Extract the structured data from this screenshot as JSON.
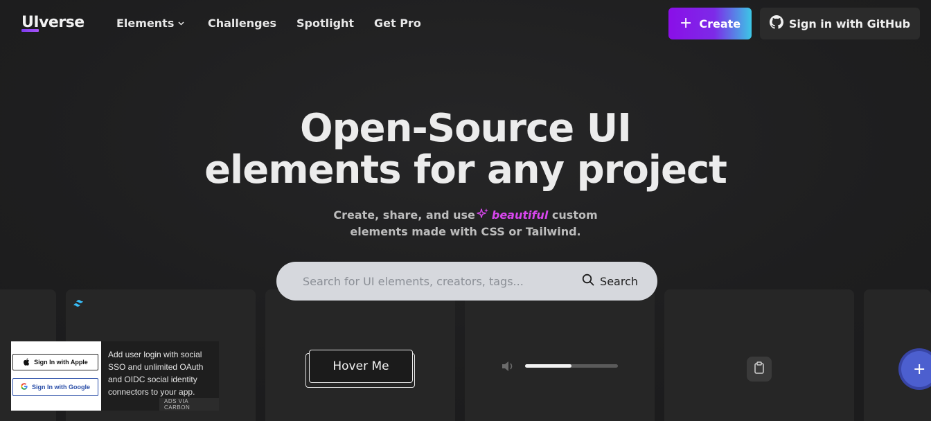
{
  "nav": {
    "logo_ui": "UI",
    "logo_rest": "verse",
    "links": [
      {
        "label": "Elements",
        "has_dropdown": true
      },
      {
        "label": "Challenges"
      },
      {
        "label": "Spotlight"
      },
      {
        "label": "Get Pro"
      }
    ],
    "create_label": "Create",
    "github_label": "Sign in with GitHub"
  },
  "hero": {
    "title_line1": "Open-Source UI",
    "title_line2": "elements for any project",
    "subtitle_pre": "Create, share, and use",
    "subtitle_highlight": "beautiful",
    "subtitle_post": "custom",
    "subtitle_line2": "elements made with CSS or Tailwind."
  },
  "search": {
    "placeholder": "Search for UI elements, creators, tags...",
    "button_label": "Search"
  },
  "cards": {
    "hover_button_label": "Hover Me",
    "volume_level": 0.5
  },
  "ad": {
    "apple_label": "Sign In with Apple",
    "google_label": "Sign In with Google",
    "text": "Add user login with social SSO and unlimited OAuth and OIDC social identity connectors to your app.",
    "via_label": "ADS VIA CARBON"
  },
  "colors": {
    "background": "#212121",
    "accent_purple": "#8a0fe8",
    "accent_cyan": "#3cc7e6",
    "highlight_pink": "#d946ef",
    "fab_blue": "#4c5fcf"
  }
}
